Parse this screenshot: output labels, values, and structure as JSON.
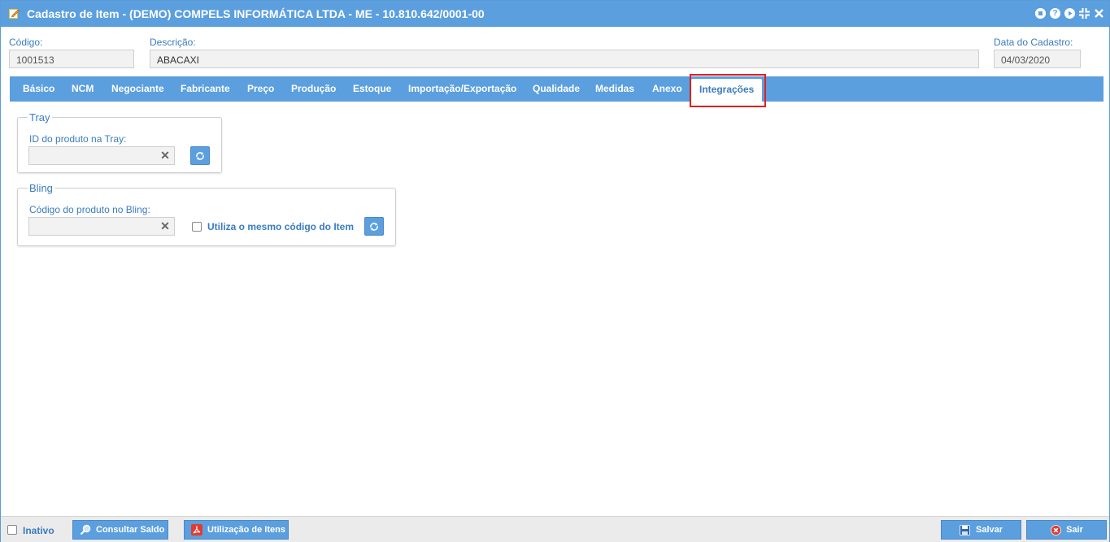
{
  "window": {
    "title": "Cadastro de Item - (DEMO) COMPELS INFORMÁTICA LTDA - ME - 10.810.642/0001-00",
    "controls": [
      "minimize-icon",
      "help-icon",
      "play-icon",
      "collapse-icon",
      "close-icon"
    ],
    "help_glyph": "?"
  },
  "header": {
    "codigo_label": "Código:",
    "codigo_value": "1001513",
    "descricao_label": "Descrição:",
    "descricao_value": "ABACAXI",
    "data_label": "Data do Cadastro:",
    "data_value": "04/03/2020"
  },
  "tabs": [
    {
      "label": "Básico"
    },
    {
      "label": "NCM"
    },
    {
      "label": "Negociante"
    },
    {
      "label": "Fabricante"
    },
    {
      "label": "Preço"
    },
    {
      "label": "Produção"
    },
    {
      "label": "Estoque"
    },
    {
      "label": "Importação/Exportação"
    },
    {
      "label": "Qualidade"
    },
    {
      "label": "Medidas"
    },
    {
      "label": "Anexo"
    },
    {
      "label": "Integrações",
      "active": true
    }
  ],
  "tray": {
    "legend": "Tray",
    "field_label": "ID do produto na Tray:",
    "field_value": "",
    "clear_glyph": "✕"
  },
  "bling": {
    "legend": "Bling",
    "field_label": "Código do produto no Bling:",
    "field_value": "",
    "clear_glyph": "✕",
    "checkbox_label": "Utiliza o mesmo código do Item",
    "checkbox_checked": false
  },
  "footer": {
    "inativo_label": "Inativo",
    "inativo_checked": false,
    "consultar_saldo_label": "Consultar Saldo",
    "utilizacao_itens_label": "Utilização de Itens",
    "salvar_label": "Salvar",
    "sair_label": "Sair"
  },
  "colors": {
    "accent": "#5b9fdf",
    "label_text": "#3a7cc0",
    "highlight": "#e0201f",
    "field_bg": "#f2f2f2"
  }
}
